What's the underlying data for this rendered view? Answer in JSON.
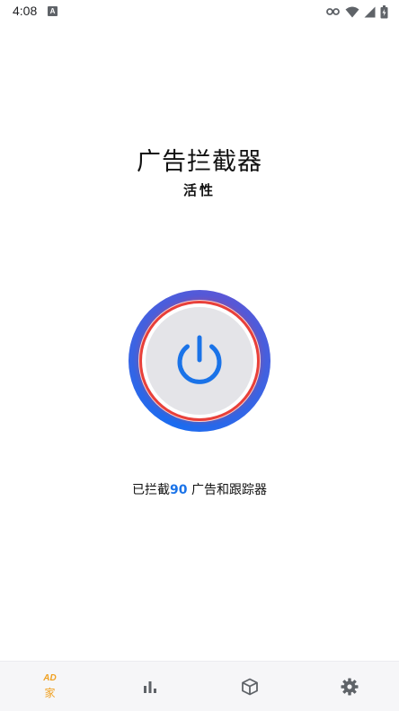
{
  "status_bar": {
    "time": "4:08",
    "notification_icon": "A",
    "icons": [
      "vpn-key-icon",
      "wifi-icon",
      "cell-signal-icon",
      "battery-icon"
    ]
  },
  "header": {
    "title": "广告拦截器",
    "status": "活性"
  },
  "power_button": {
    "icon": "power-icon",
    "ring_color": "#1a6cf0",
    "glow_color": "#e8403a",
    "symbol_color": "#1a73e8"
  },
  "blocked": {
    "prefix": "已拦截",
    "count": "90",
    "suffix": " 广告和跟踪器"
  },
  "bottom_nav": {
    "items": [
      {
        "icon": "ad-icon",
        "icon_text": "AD",
        "label": "家",
        "active": true
      },
      {
        "icon": "bar-chart-icon",
        "label": ""
      },
      {
        "icon": "box-icon",
        "label": ""
      },
      {
        "icon": "gear-icon",
        "label": ""
      }
    ],
    "active_color": "#f0a020"
  }
}
